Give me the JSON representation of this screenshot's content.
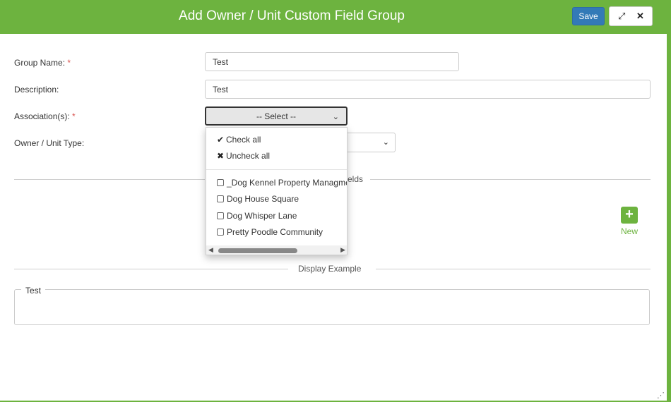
{
  "header": {
    "title": "Add Owner / Unit Custom Field Group",
    "save_label": "Save",
    "expand_glyph": "⤢",
    "close_glyph": "✕"
  },
  "form": {
    "group_name": {
      "label": "Group Name:",
      "required_mark": "*",
      "value": "Test"
    },
    "description": {
      "label": "Description:",
      "value": "Test"
    },
    "associations": {
      "label": "Association(s):",
      "required_mark": "*",
      "selected": "-- Select --"
    },
    "owner_unit_type": {
      "label": "Owner / Unit Type:"
    }
  },
  "fields_section": {
    "label_fragment": "elds"
  },
  "new_button": {
    "label": "New",
    "glyph": "+"
  },
  "display_example": {
    "label": "Display Example",
    "legend": "Test"
  },
  "dropdown": {
    "check_all": "Check all",
    "uncheck_all": "Uncheck all",
    "options": [
      "_Dog Kennel Property Managment",
      "Dog House Square",
      "Dog Whisper Lane",
      "Pretty Poodle Community"
    ]
  },
  "icons": {
    "check_all": "checkmark-icon",
    "uncheck_all": "x-mark-icon",
    "new": "plus-icon"
  },
  "colors": {
    "header": "#6db33f",
    "save_button": "#337ab7",
    "required": "#d9534f",
    "new_button": "#6db33f"
  }
}
